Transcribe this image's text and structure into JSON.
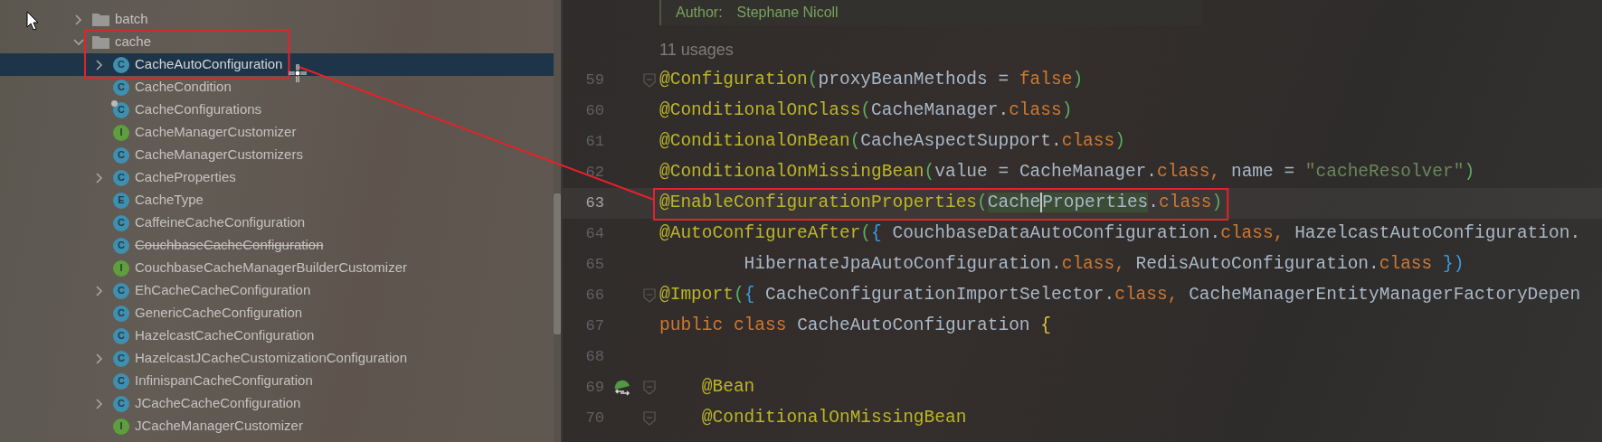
{
  "project_tree": {
    "items": [
      {
        "label": "batch",
        "kind": "folder",
        "expanded": false,
        "selected": false
      },
      {
        "label": "cache",
        "kind": "folder",
        "expanded": true,
        "selected": false,
        "boxed": true,
        "children": [
          {
            "label": "CacheAutoConfiguration",
            "kind": "class",
            "badge": "C",
            "expanded": false,
            "selected": true,
            "boxed": true
          },
          {
            "label": "CacheCondition",
            "kind": "class",
            "badge": "C",
            "selected": false
          },
          {
            "label": "CacheConfigurations",
            "kind": "class",
            "badge": "C",
            "overlay": true,
            "selected": false
          },
          {
            "label": "CacheManagerCustomizer",
            "kind": "interface",
            "badge": "I",
            "selected": false
          },
          {
            "label": "CacheManagerCustomizers",
            "kind": "class",
            "badge": "C",
            "selected": false
          },
          {
            "label": "CacheProperties",
            "kind": "class",
            "badge": "C",
            "expanded": false,
            "selected": false
          },
          {
            "label": "CacheType",
            "kind": "enum",
            "badge": "E",
            "selected": false
          },
          {
            "label": "CaffeineCacheConfiguration",
            "kind": "class",
            "badge": "C",
            "selected": false
          },
          {
            "label": "CouchbaseCacheConfiguration",
            "kind": "class",
            "badge": "C",
            "deprecated": true,
            "selected": false
          },
          {
            "label": "CouchbaseCacheManagerBuilderCustomizer",
            "kind": "interface",
            "badge": "I",
            "selected": false
          },
          {
            "label": "EhCacheCacheConfiguration",
            "kind": "class",
            "badge": "C",
            "expanded": false,
            "selected": false
          },
          {
            "label": "GenericCacheConfiguration",
            "kind": "class",
            "badge": "C",
            "selected": false
          },
          {
            "label": "HazelcastCacheConfiguration",
            "kind": "class",
            "badge": "C",
            "selected": false
          },
          {
            "label": "HazelcastJCacheCustomizationConfiguration",
            "kind": "class",
            "badge": "C",
            "expanded": false,
            "selected": false
          },
          {
            "label": "InfinispanCacheConfiguration",
            "kind": "class",
            "badge": "C",
            "selected": false
          },
          {
            "label": "JCacheCacheConfiguration",
            "kind": "class",
            "badge": "C",
            "expanded": false,
            "selected": false
          },
          {
            "label": "JCacheManagerCustomizer",
            "kind": "interface",
            "badge": "I",
            "selected": false
          }
        ]
      }
    ]
  },
  "editor": {
    "doc": {
      "label": "Author:",
      "value": "Stephane Nicoll"
    },
    "usages": "11 usages",
    "lines": [
      {
        "number": "59",
        "fold": true,
        "current": false,
        "tokens": [
          {
            "text": "@Configuration",
            "kind": "annotation"
          },
          {
            "text": "(",
            "kind": "paren"
          },
          {
            "text": "proxyBeanMethods = ",
            "kind": "plain"
          },
          {
            "text": "false",
            "kind": "keyword"
          },
          {
            "text": ")",
            "kind": "paren"
          }
        ]
      },
      {
        "number": "60",
        "fold": false,
        "current": false,
        "tokens": [
          {
            "text": "@ConditionalOnClass",
            "kind": "annotation"
          },
          {
            "text": "(",
            "kind": "paren"
          },
          {
            "text": "CacheManager.",
            "kind": "plain"
          },
          {
            "text": "class",
            "kind": "keyword"
          },
          {
            "text": ")",
            "kind": "paren"
          }
        ]
      },
      {
        "number": "61",
        "fold": false,
        "current": false,
        "tokens": [
          {
            "text": "@ConditionalOnBean",
            "kind": "annotation"
          },
          {
            "text": "(",
            "kind": "paren"
          },
          {
            "text": "CacheAspectSupport.",
            "kind": "plain"
          },
          {
            "text": "class",
            "kind": "keyword"
          },
          {
            "text": ")",
            "kind": "paren"
          }
        ]
      },
      {
        "number": "62",
        "fold": false,
        "current": false,
        "tokens": [
          {
            "text": "@ConditionalOnMissingBean",
            "kind": "annotation"
          },
          {
            "text": "(",
            "kind": "paren"
          },
          {
            "text": "value = CacheManager.",
            "kind": "plain"
          },
          {
            "text": "class",
            "kind": "keyword"
          },
          {
            "text": ", ",
            "kind": "keyword"
          },
          {
            "text": "name = ",
            "kind": "plain"
          },
          {
            "text": "\"cacheResolver\"",
            "kind": "string"
          },
          {
            "text": ")",
            "kind": "paren"
          }
        ]
      },
      {
        "number": "63",
        "fold": false,
        "current": true,
        "boxed": true,
        "tokens": [
          {
            "text": "@EnableConfigurationProperties",
            "kind": "annotation"
          },
          {
            "text": "(",
            "kind": "paren"
          },
          {
            "text": "Cache",
            "kind": "plain",
            "marked": true,
            "caret": true
          },
          {
            "text": "Properties",
            "kind": "plain",
            "marked": true
          },
          {
            "text": ".",
            "kind": "plain"
          },
          {
            "text": "class",
            "kind": "keyword"
          },
          {
            "text": ")",
            "kind": "paren"
          }
        ]
      },
      {
        "number": "64",
        "fold": false,
        "current": false,
        "tokens": [
          {
            "text": "@AutoConfigureAfter",
            "kind": "annotation"
          },
          {
            "text": "(",
            "kind": "paren"
          },
          {
            "text": "{ ",
            "kind": "brace"
          },
          {
            "text": "CouchbaseDataAutoConfiguration.",
            "kind": "plain"
          },
          {
            "text": "class",
            "kind": "keyword"
          },
          {
            "text": ", ",
            "kind": "keyword"
          },
          {
            "text": "HazelcastAutoConfiguration.",
            "kind": "plain"
          }
        ]
      },
      {
        "number": "65",
        "fold": false,
        "current": false,
        "tokens": [
          {
            "text": "        HibernateJpaAutoConfiguration.",
            "kind": "plain"
          },
          {
            "text": "class",
            "kind": "keyword"
          },
          {
            "text": ", ",
            "kind": "keyword"
          },
          {
            "text": "RedisAutoConfiguration.",
            "kind": "plain"
          },
          {
            "text": "class",
            "kind": "keyword"
          },
          {
            "text": " })",
            "kind": "brace"
          }
        ]
      },
      {
        "number": "66",
        "fold": true,
        "current": false,
        "tokens": [
          {
            "text": "@Import",
            "kind": "annotation"
          },
          {
            "text": "(",
            "kind": "paren"
          },
          {
            "text": "{ ",
            "kind": "brace"
          },
          {
            "text": "CacheConfigurationImportSelector.",
            "kind": "plain"
          },
          {
            "text": "class",
            "kind": "keyword"
          },
          {
            "text": ", ",
            "kind": "keyword"
          },
          {
            "text": "CacheManagerEntityManagerFactoryDepen",
            "kind": "plain"
          }
        ]
      },
      {
        "number": "67",
        "fold": false,
        "current": false,
        "tokens": [
          {
            "text": "public class ",
            "kind": "keyword"
          },
          {
            "text": "CacheAutoConfiguration ",
            "kind": "plain"
          },
          {
            "text": "{",
            "kind": "brace2"
          }
        ]
      },
      {
        "number": "68",
        "fold": false,
        "current": false
      },
      {
        "number": "69",
        "fold": true,
        "current": false,
        "bean_marker": true,
        "tokens": [
          {
            "text": "    @Bean",
            "kind": "annotation"
          }
        ]
      },
      {
        "number": "70",
        "fold": true,
        "current": false,
        "tokens": [
          {
            "text": "    @ConditionalOnMissingBean",
            "kind": "annotation"
          }
        ]
      }
    ]
  },
  "markup": {
    "color": "#e8202a"
  }
}
